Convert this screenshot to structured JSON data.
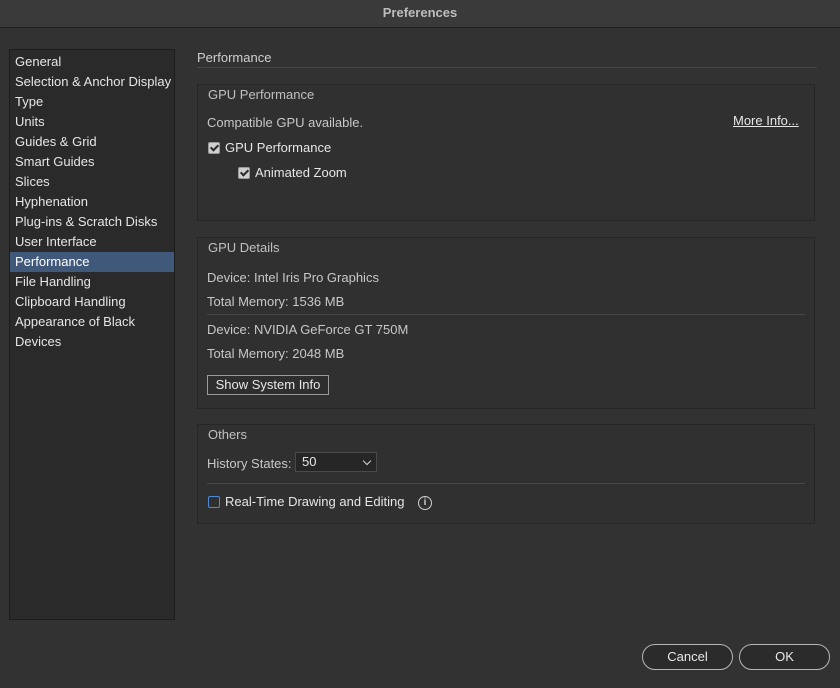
{
  "window": {
    "title": "Preferences"
  },
  "sidebar": {
    "items": [
      {
        "label": "General",
        "selected": false
      },
      {
        "label": "Selection & Anchor Display",
        "selected": false
      },
      {
        "label": "Type",
        "selected": false
      },
      {
        "label": "Units",
        "selected": false
      },
      {
        "label": "Guides & Grid",
        "selected": false
      },
      {
        "label": "Smart Guides",
        "selected": false
      },
      {
        "label": "Slices",
        "selected": false
      },
      {
        "label": "Hyphenation",
        "selected": false
      },
      {
        "label": "Plug-ins & Scratch Disks",
        "selected": false
      },
      {
        "label": "User Interface",
        "selected": false
      },
      {
        "label": "Performance",
        "selected": true
      },
      {
        "label": "File Handling",
        "selected": false
      },
      {
        "label": "Clipboard Handling",
        "selected": false
      },
      {
        "label": "Appearance of Black",
        "selected": false
      },
      {
        "label": "Devices",
        "selected": false
      }
    ]
  },
  "page": {
    "title": "Performance"
  },
  "gpu_performance": {
    "title": "GPU Performance",
    "status": "Compatible GPU available.",
    "more_info": "More Info...",
    "gpu_checkbox": {
      "label": "GPU Performance",
      "checked": true
    },
    "zoom_checkbox": {
      "label": "Animated Zoom",
      "checked": true
    }
  },
  "gpu_details": {
    "title": "GPU Details",
    "devices": [
      {
        "device": "Device: Intel Iris Pro Graphics",
        "memory": "Total Memory: 1536 MB"
      },
      {
        "device": "Device: NVIDIA GeForce GT 750M",
        "memory": "Total Memory: 2048 MB"
      }
    ],
    "system_info_button": "Show System Info"
  },
  "others": {
    "title": "Others",
    "history_label": "History States:",
    "history_value": "50",
    "realtime_checkbox": {
      "label": "Real-Time Drawing and Editing",
      "checked": false
    }
  },
  "footer": {
    "cancel": "Cancel",
    "ok": "OK"
  },
  "colors": {
    "accent": "#40597a",
    "background": "#323232"
  }
}
